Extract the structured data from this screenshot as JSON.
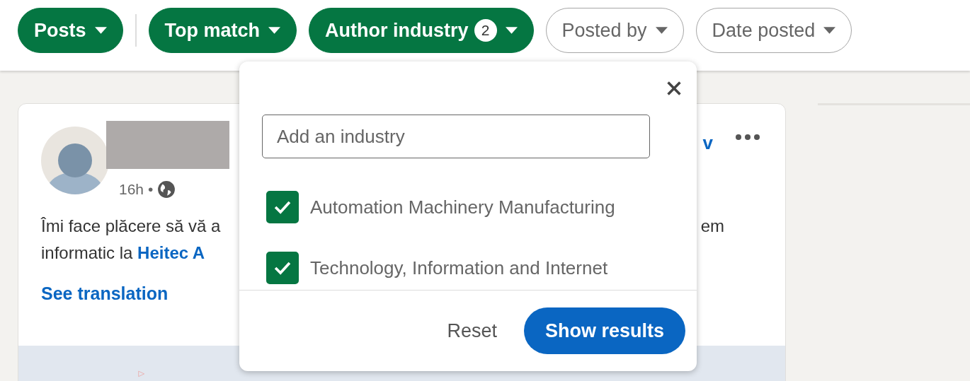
{
  "filters": [
    {
      "label": "Posts",
      "selected": true,
      "divider_after": true
    },
    {
      "label": "Top match",
      "selected": true,
      "divider_after": false
    },
    {
      "label": "Author industry",
      "selected": true,
      "count": "2",
      "divider_after": false
    },
    {
      "label": "Posted by",
      "selected": false,
      "divider_after": false
    },
    {
      "label": "Date posted",
      "selected": false,
      "divider_after": false
    }
  ],
  "post": {
    "time": "16h",
    "separator": "•",
    "header_link_fragment": "v",
    "body_line_1_left": "Îmi face plăcere să vă a",
    "body_line_1_right": "em",
    "body_line_2_text": "informatic la ",
    "body_line_2_link": "Heitec A",
    "see_translation": "See translation"
  },
  "industry_popup": {
    "placeholder": "Add an industry",
    "options": [
      {
        "label": "Automation Machinery Manufacturing",
        "checked": true
      },
      {
        "label": "Technology, Information and Internet",
        "checked": true
      }
    ],
    "reset": "Reset",
    "submit": "Show results"
  }
}
